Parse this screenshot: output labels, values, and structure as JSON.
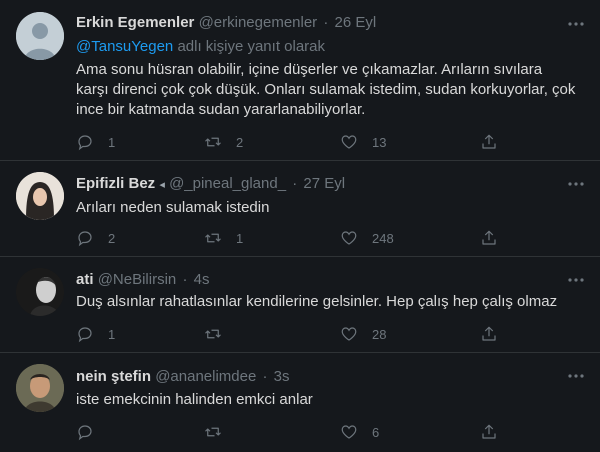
{
  "colors": {
    "background": "#15181c",
    "text": "#d9d9d9",
    "muted": "#6e767d",
    "accent": "#1d9bf0",
    "divider": "#2f3336"
  },
  "tweets": [
    {
      "name": "Erkin Egemenler",
      "handle": "@erkinegemenler",
      "time": "26 Eyl",
      "reply_mention": "@TansuYegen",
      "reply_suffix": "adlı kişiye yanıt olarak",
      "text": "Ama sonu hüsran olabilir, içine düşerler ve çıkamazlar. Arıların sıvılara karşı direnci çok çok düşük. Onları sulamak istedim, sudan korkuyorlar, çok ince bir katmanda sudan yararlanabiliyorlar.",
      "counts": {
        "reply": "1",
        "retweet": "2",
        "like": "13"
      }
    },
    {
      "name": "Epifizli Bez",
      "handle": "@_pineal_gland_",
      "time": "27 Eyl",
      "text": "Arıları neden sulamak istedin",
      "counts": {
        "reply": "2",
        "retweet": "1",
        "like": "248"
      }
    },
    {
      "name": "ati",
      "handle": "@NeBilirsin",
      "time": "4s",
      "text": "Duş alsınlar rahatlasınlar kendilerine gelsinler. Hep çalış hep çalış olmaz",
      "counts": {
        "reply": "1",
        "retweet": "",
        "like": "28"
      }
    },
    {
      "name": "nein ştefin",
      "handle": "@ananelimdee",
      "time": "3s",
      "text": "iste emekcinin halinden emkci anlar",
      "counts": {
        "reply": "",
        "retweet": "",
        "like": "6"
      }
    }
  ],
  "icons": {
    "reply": "reply-icon",
    "retweet": "retweet-icon",
    "like": "like-icon",
    "share": "share-icon",
    "more": "more-icon"
  }
}
